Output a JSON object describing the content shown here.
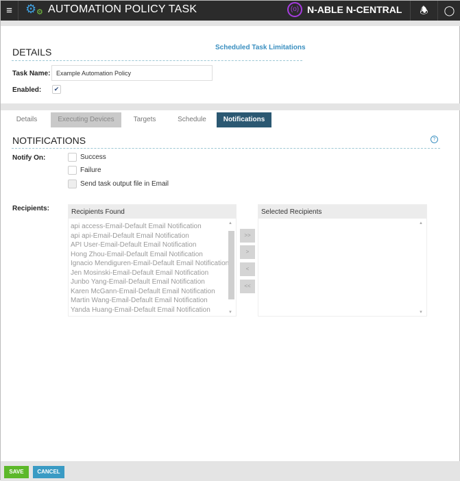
{
  "header": {
    "title": "AUTOMATION POLICY TASK",
    "brand": "N-ABLE N-CENTRAL"
  },
  "details": {
    "heading": "DETAILS",
    "limitations_link": "Scheduled Task Limitations",
    "task_name_label": "Task Name:",
    "task_name_value": "Example Automation Policy",
    "enabled_label": "Enabled:",
    "enabled": true
  },
  "tabs": [
    "Details",
    "Executing Devices",
    "Targets",
    "Schedule",
    "Notifications"
  ],
  "active_tab": "Notifications",
  "notifications": {
    "heading": "NOTIFICATIONS",
    "notify_on_label": "Notify On:",
    "options": [
      {
        "label": "Success",
        "checked": false
      },
      {
        "label": "Failure",
        "checked": false
      },
      {
        "label": "Send task output file in Email",
        "checked": false,
        "disabled": true
      }
    ],
    "recipients_label": "Recipients:",
    "found_header": "Recipients Found",
    "selected_header": "Selected Recipients",
    "found": [
      "api access-Email-Default Email Notification",
      "api api-Email-Default Email Notification",
      "API User-Email-Default Email Notification",
      "Hong Zhou-Email-Default Email Notification",
      "Ignacio Mendiguren-Email-Default Email Notification",
      "Jen Mosinski-Email-Default Email Notification",
      "Junbo Yang-Email-Default Email Notification",
      "Karen McGann-Email-Default Email Notification",
      "Martin Wang-Email-Default Email Notification",
      "Yanda Huang-Email-Default Email Notification"
    ],
    "selected": [],
    "move_buttons": [
      ">>",
      ">",
      "<",
      "<<"
    ]
  },
  "footer": {
    "save": "SAVE",
    "cancel": "CANCEL"
  },
  "colors": {
    "header": "#2b2b2b",
    "active_tab": "#2b5872",
    "save": "#5cb82a",
    "cancel": "#3a9bc4",
    "link": "#3a8fc0",
    "brand": "#a63ce0"
  }
}
